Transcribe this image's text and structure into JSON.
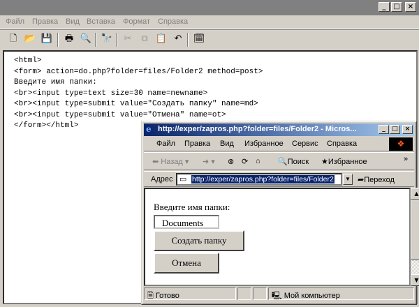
{
  "app": {
    "window_buttons": [
      "_",
      "□",
      "×"
    ],
    "menu": [
      "Файл",
      "Правка",
      "Вид",
      "Вставка",
      "Формат",
      "Справка"
    ],
    "toolbar_icons": [
      "new-document-icon",
      "open-folder-icon",
      "save-icon",
      "print-icon",
      "print-preview-icon",
      "find-icon",
      "cut-icon",
      "copy-icon",
      "paste-icon",
      "undo-icon",
      "insert-datetime-icon"
    ]
  },
  "editor": {
    "lines": [
      "<html>",
      "<form> action=do.php?folder=files/Folder2 method=post>",
      "Введите имя папки:",
      "<br><input type=text size=30 name=newname>",
      "<br><input type=submit value=\"Создать папку\" name=md>",
      "<br><input type=submit value=\"Отмена\" name=ot>",
      "</form></html>"
    ]
  },
  "browser": {
    "title": "http://exper/zapros.php?folder=files/Folder2 - Micros...",
    "window_buttons": [
      "_",
      "□",
      "×"
    ],
    "menu": [
      "Файл",
      "Правка",
      "Вид",
      "Избранное",
      "Сервис",
      "Справка"
    ],
    "nav": {
      "back": "Назад",
      "forward_arrow": "➜",
      "search": "Поиск",
      "favorites": "Избранное",
      "more": "»"
    },
    "address": {
      "label": "Адрес",
      "url": "http://exper/zapros.php?folder=files/Folder2",
      "go": "Переход"
    },
    "page": {
      "prompt": "Введите имя папки:",
      "input_value": "Documents",
      "create_button": "Создать папку",
      "cancel_button": "Отмена"
    },
    "status": {
      "text": "Готово",
      "zone": "Мой компьютер"
    }
  }
}
